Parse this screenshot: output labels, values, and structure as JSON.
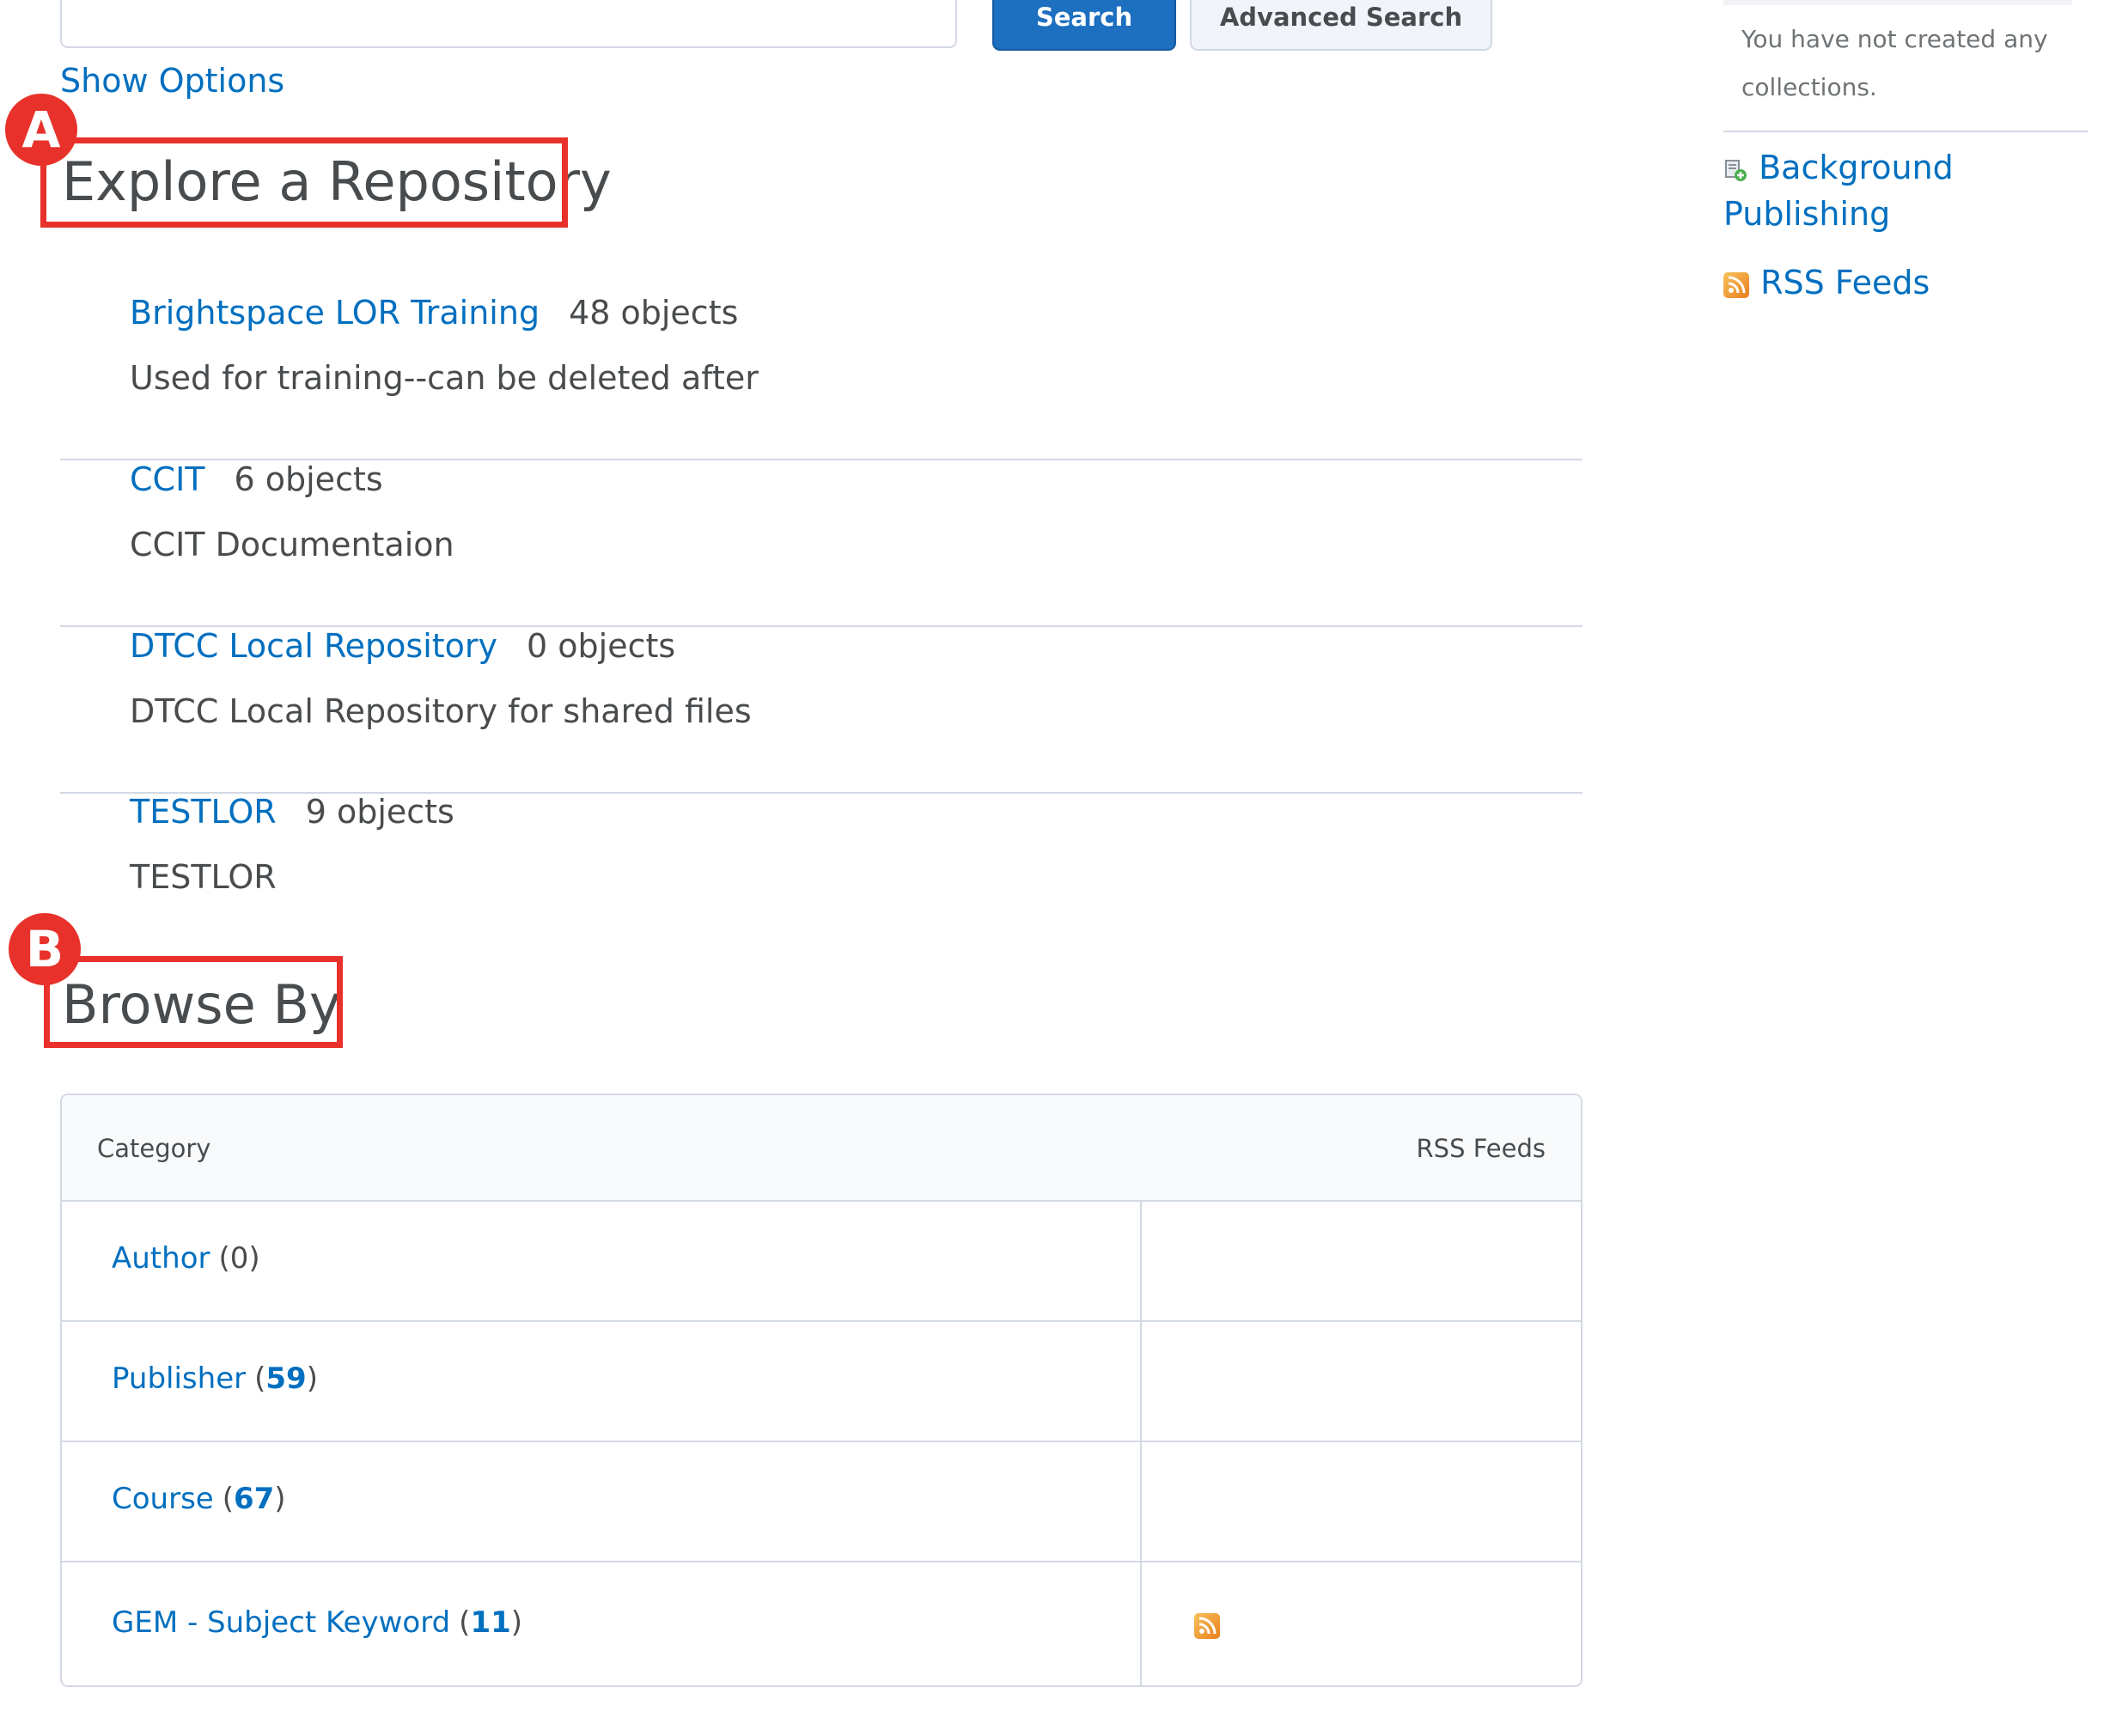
{
  "search": {
    "search_button": "Search",
    "advanced_search_button": "Advanced Search",
    "show_options": "Show Options"
  },
  "callouts": {
    "a": "A",
    "b": "B"
  },
  "explore": {
    "heading": "Explore a Repository",
    "repositories": [
      {
        "name": "Brightspace LOR Training",
        "count": "48 objects",
        "description": "Used for training--can be deleted after"
      },
      {
        "name": "CCIT",
        "count": "6 objects",
        "description": "CCIT Documentaion"
      },
      {
        "name": "DTCC Local Repository",
        "count": "0 objects",
        "description": "DTCC Local Repository for shared files"
      },
      {
        "name": "TESTLOR",
        "count": "9 objects",
        "description": "TESTLOR"
      }
    ]
  },
  "browse": {
    "heading": "Browse By",
    "columns": {
      "category": "Category",
      "rss": "RSS Feeds"
    },
    "rows": [
      {
        "label": "Author",
        "open": "(",
        "count": "0",
        "close": ")",
        "count_is_link": false,
        "rss": false
      },
      {
        "label": "Publisher",
        "open": "(",
        "count": "59",
        "close": ")",
        "count_is_link": true,
        "rss": false
      },
      {
        "label": "Course",
        "open": "(",
        "count": "67",
        "close": ")",
        "count_is_link": true,
        "rss": false
      },
      {
        "label": "GEM - Subject Keyword",
        "open": "(",
        "count": "11",
        "close": ")",
        "count_is_link": true,
        "rss": true
      }
    ]
  },
  "sidebar": {
    "collections_note": "You have not created any collections.",
    "background_publishing": "Background Publishing",
    "rss_feeds": "RSS Feeds"
  },
  "colors": {
    "link": "#006fbf",
    "primary_button": "#1d6fc0",
    "callout_red": "#e8312a",
    "text": "#494c4e",
    "border": "#d3d9e3"
  }
}
